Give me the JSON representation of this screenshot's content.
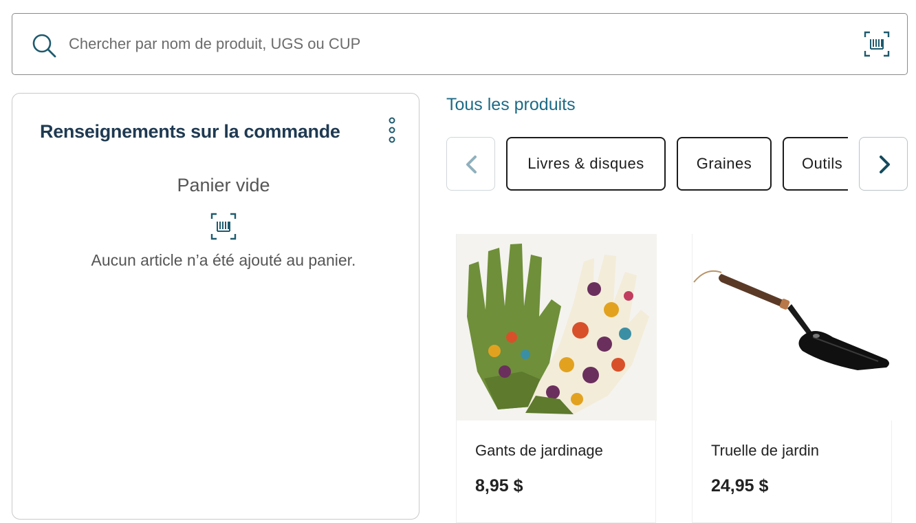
{
  "search": {
    "placeholder": "Chercher par nom de produit, UGS ou CUP",
    "icon": "search-icon",
    "scan_icon": "barcode-scan-icon"
  },
  "order": {
    "title": "Renseignements sur la commande",
    "menu_icon": "more-vertical-icon",
    "empty_title": "Panier vide",
    "empty_icon": "barcode-scan-icon",
    "empty_message": "Aucun article n’a été ajouté au panier."
  },
  "catalog": {
    "heading": "Tous les produits",
    "categories": [
      {
        "label": "Livres & disques"
      },
      {
        "label": "Graines"
      },
      {
        "label": "Outils"
      }
    ],
    "prev_icon": "chevron-left-icon",
    "next_icon": "chevron-right-icon",
    "products": [
      {
        "name": "Gants de jardinage",
        "price": "8,95 $",
        "image": "floral-gardening-gloves"
      },
      {
        "name": "Truelle de jardin",
        "price": "24,95 $",
        "image": "garden-trowel"
      }
    ]
  },
  "colors": {
    "accent": "#1d6a85",
    "title": "#1f3a52",
    "chevron_disabled": "#8fb0bd",
    "chevron_active": "#134a5e"
  }
}
